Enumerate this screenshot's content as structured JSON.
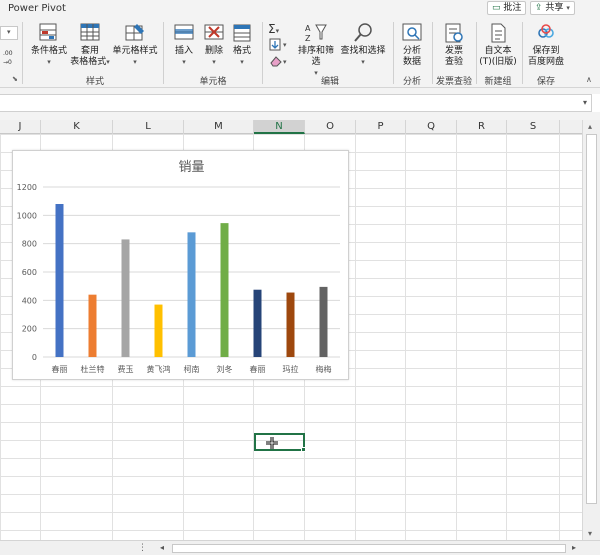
{
  "ribbon": {
    "tab_power_pivot": "Power Pivot",
    "comment_button": "批注",
    "share_button": "共享",
    "number_format": {
      "decimals": ".00\n→.0"
    },
    "styles": {
      "conditional_format": "条件格式",
      "format_as_table_1": "套用",
      "format_as_table_2": "表格格式",
      "cell_styles": "单元格样式",
      "group_label": "样式"
    },
    "cells": {
      "insert": "插入",
      "delete": "删除",
      "format": "格式",
      "group_label": "单元格"
    },
    "editing": {
      "sort_filter": "排序和筛选",
      "find_select": "查找和选择",
      "group_label": "编辑"
    },
    "analysis": {
      "analyze_data_1": "分析",
      "analyze_data_2": "数据",
      "group_label": "分析"
    },
    "invoice": {
      "check_1": "发票",
      "check_2": "查验",
      "group_label": "发票查验"
    },
    "new_group": {
      "btn_1": "自文本",
      "btn_2": "(T)(旧版)",
      "group_label": "新建组"
    },
    "save": {
      "btn_1": "保存到",
      "btn_2": "百度网盘",
      "group_label": "保存"
    },
    "number_group_expand": "⬊"
  },
  "columns": [
    {
      "label": "J",
      "selected": false
    },
    {
      "label": "K",
      "selected": false
    },
    {
      "label": "L",
      "selected": false
    },
    {
      "label": "M",
      "selected": false
    },
    {
      "label": "N",
      "selected": true
    },
    {
      "label": "O",
      "selected": false
    },
    {
      "label": "P",
      "selected": false
    },
    {
      "label": "Q",
      "selected": false
    },
    {
      "label": "R",
      "selected": false
    },
    {
      "label": "S",
      "selected": false
    }
  ],
  "colors": {
    "excel_green": "#217346"
  },
  "chart_data": {
    "type": "bar",
    "title": "销量",
    "categories": [
      "春丽",
      "杜兰特",
      "费玉",
      "黄飞鸿",
      "柯南",
      "刘冬",
      "春丽",
      "玛拉",
      "梅梅"
    ],
    "values": [
      1080,
      440,
      830,
      370,
      880,
      945,
      475,
      455,
      495
    ],
    "colors": [
      "#4472C4",
      "#ED7D31",
      "#A5A5A5",
      "#FFC000",
      "#5B9BD5",
      "#70AD47",
      "#264478",
      "#9E480E",
      "#636363"
    ],
    "yticks": [
      0,
      200,
      400,
      600,
      800,
      1000,
      1200
    ],
    "ylim": [
      0,
      1200
    ],
    "grid": true,
    "legend": "none"
  }
}
